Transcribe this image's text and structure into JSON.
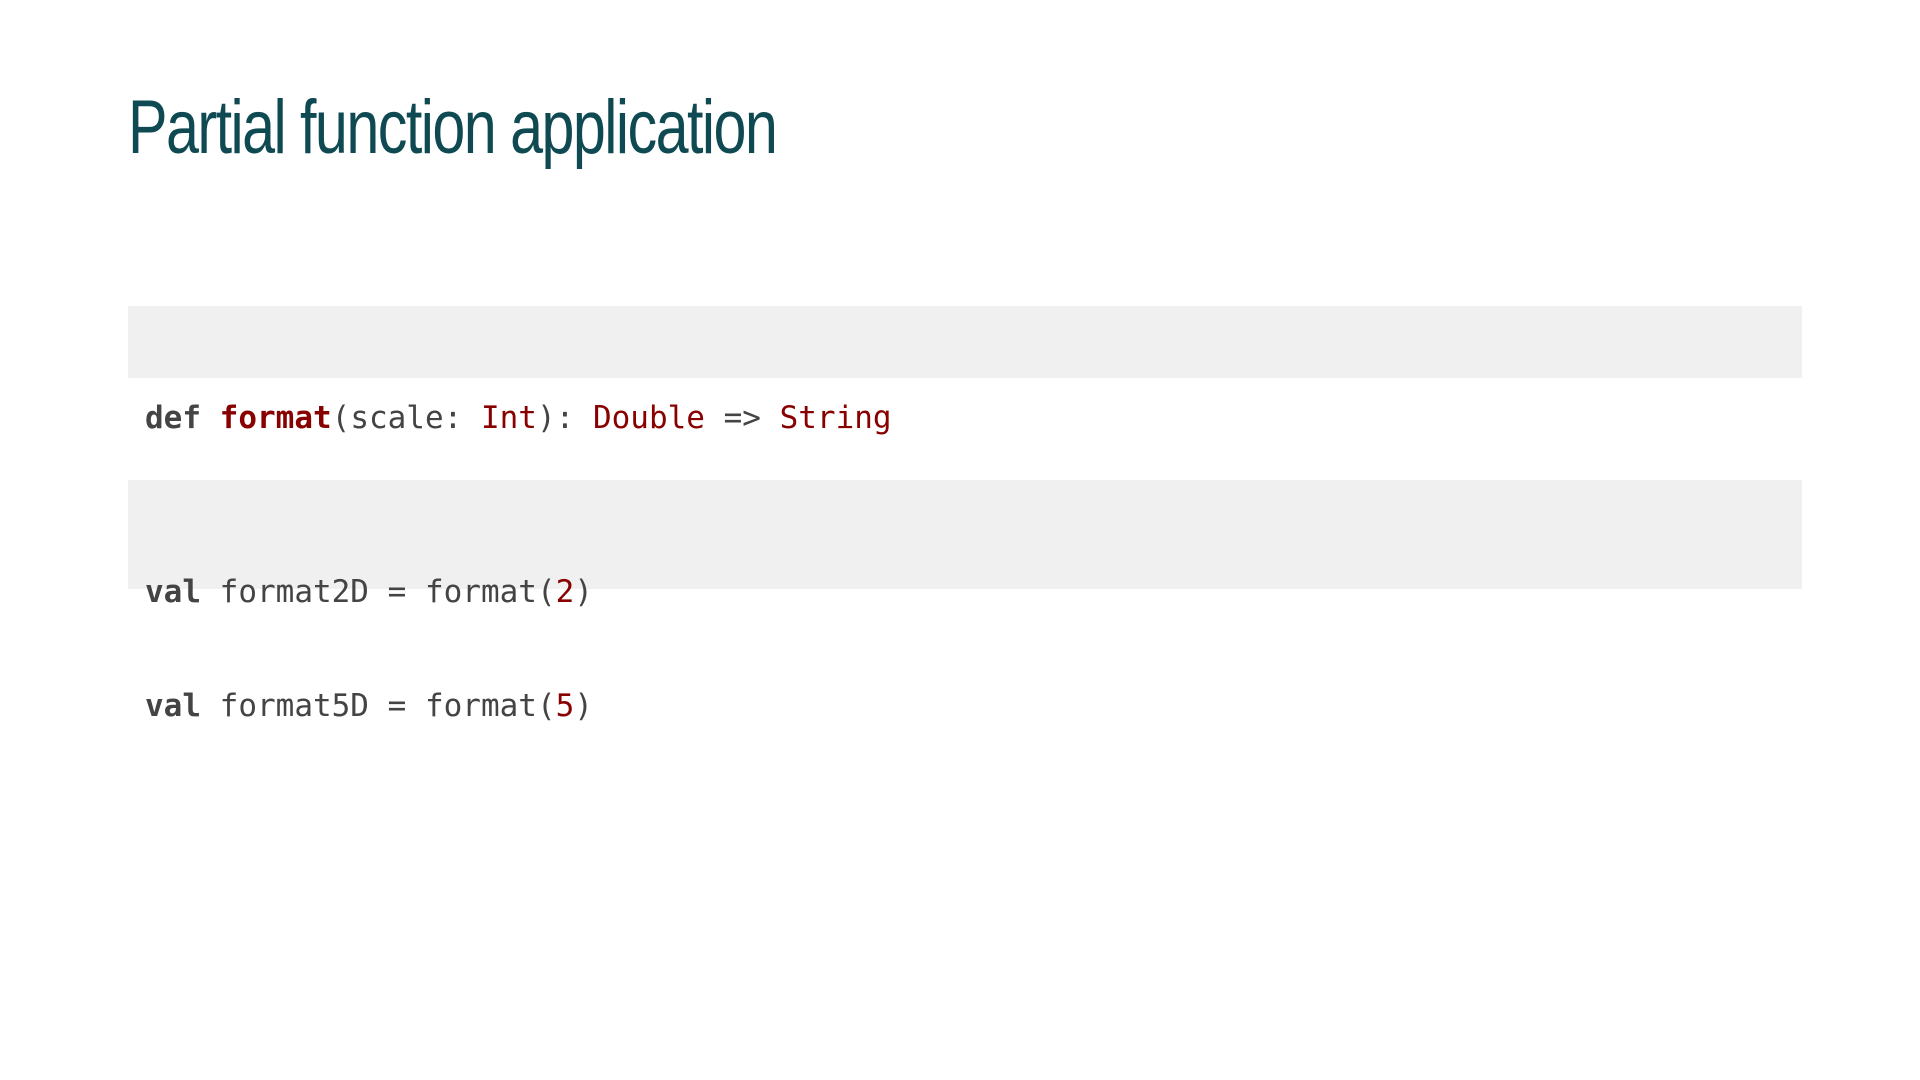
{
  "slide": {
    "title": "Partial function application"
  },
  "code_blocks": [
    {
      "lines": [
        {
          "tokens": [
            {
              "text": "def",
              "kind": "keyword"
            },
            {
              "text": " ",
              "kind": "plain"
            },
            {
              "text": "format",
              "kind": "function-name"
            },
            {
              "text": "(scale: ",
              "kind": "plain"
            },
            {
              "text": "Int",
              "kind": "type"
            },
            {
              "text": "): ",
              "kind": "plain"
            },
            {
              "text": "Double",
              "kind": "type"
            },
            {
              "text": " => ",
              "kind": "plain"
            },
            {
              "text": "String",
              "kind": "type"
            }
          ]
        }
      ]
    },
    {
      "lines": [
        {
          "tokens": [
            {
              "text": "val",
              "kind": "keyword"
            },
            {
              "text": " format2D = format(",
              "kind": "plain"
            },
            {
              "text": "2",
              "kind": "number"
            },
            {
              "text": ")",
              "kind": "plain"
            }
          ]
        },
        {
          "tokens": [
            {
              "text": "val",
              "kind": "keyword"
            },
            {
              "text": " format5D = format(",
              "kind": "plain"
            },
            {
              "text": "5",
              "kind": "number"
            },
            {
              "text": ")",
              "kind": "plain"
            }
          ]
        }
      ]
    }
  ],
  "colors": {
    "title": "#0f4a52",
    "code_background": "#f0f0f0",
    "code_text": "#444444",
    "code_accent": "#880000"
  }
}
